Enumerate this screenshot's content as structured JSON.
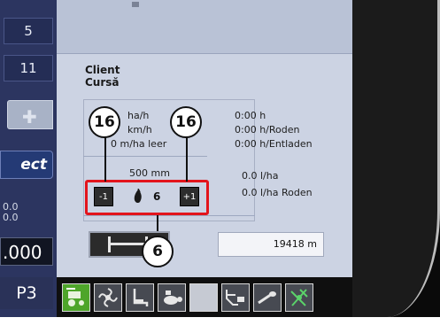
{
  "sidebar": {
    "value_top": "5",
    "value_second": "11",
    "logo_text": "ect",
    "small_values": [
      "0.0",
      "0.0"
    ],
    "display_value": ".000",
    "page_label": "P3"
  },
  "main": {
    "client_label": "Client",
    "course_label": "Cursă",
    "stats_left": [
      "ha/h",
      "km/h",
      "0 m/ha leer"
    ],
    "stats_right": [
      "0:00 h",
      "0:00 h/Roden",
      "0:00 h/Entladen"
    ],
    "spacing": "500 mm",
    "rates": [
      "0.0 l/ha",
      "0.0 l/ha Roden"
    ],
    "minus_label": "-1",
    "plus_label": "+1",
    "seed_value": "6",
    "distance_value": "19418 m"
  },
  "callouts": {
    "left": "16",
    "right": "16",
    "bottom": "6"
  },
  "toolbar": {
    "icons": [
      "tractor-icon",
      "fan-icon",
      "seat-icon",
      "turtle-icon",
      "blank-tool",
      "hopper-icon",
      "sprayer-icon",
      "antenna-icon"
    ]
  },
  "colors": {
    "highlight": "#e3141c",
    "panel": "#ccd3e3",
    "sidebar": "#2c3560",
    "active_tool": "#4ea52a"
  }
}
